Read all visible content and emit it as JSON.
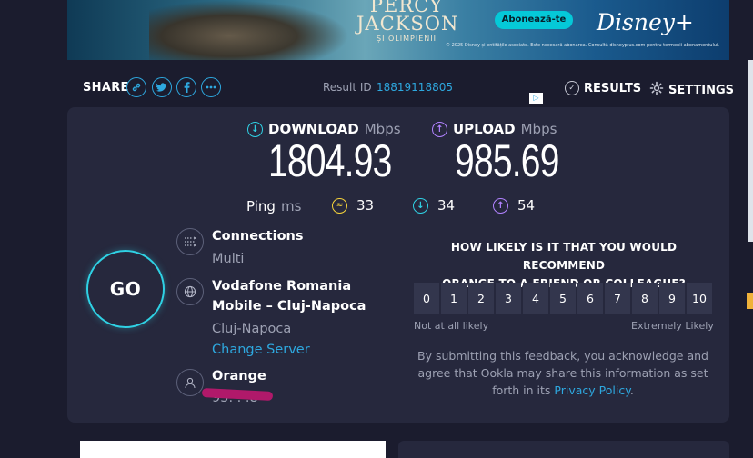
{
  "ad": {
    "title": "PERCY JACKSON",
    "subtitle": "ȘI OLIMPIENII",
    "cta": "Abonează-te",
    "brand": "Disney+",
    "fine_print": "© 2025 Disney și entitățile asociate. Este necesară abonarea. Consultă disneyplus.com pentru termenii abonamentului."
  },
  "share": {
    "label": "SHARE",
    "icons": [
      "link-icon",
      "twitter-icon",
      "facebook-icon",
      "more-icon"
    ]
  },
  "result": {
    "label": "Result ID",
    "id": "18819118805"
  },
  "nav": {
    "results": "RESULTS",
    "settings": "SETTINGS"
  },
  "download": {
    "label": "DOWNLOAD",
    "unit": "Mbps",
    "value": "1804.93",
    "color": "#2fd1e4"
  },
  "upload": {
    "label": "UPLOAD",
    "unit": "Mbps",
    "value": "985.69",
    "color": "#b182ff"
  },
  "ping": {
    "label": "Ping",
    "unit": "ms",
    "idle": "33",
    "download": "34",
    "upload": "54",
    "idle_color": "#f5d33a"
  },
  "go_label": "GO",
  "connections": {
    "title": "Connections",
    "value": "Multi"
  },
  "server": {
    "title_line1": "Vodafone Romania",
    "title_line2": "Mobile – Cluj-Napoca",
    "location": "Cluj-Napoca",
    "change_link": "Change Server"
  },
  "provider": {
    "name": "Orange",
    "ip_masked": "95.  .  .8"
  },
  "nps": {
    "question_line1": "HOW LIKELY IS IT THAT YOU WOULD RECOMMEND",
    "question_line2": "ORANGE TO A FRIEND OR COLLEAGUE?",
    "scale": [
      "0",
      "1",
      "2",
      "3",
      "4",
      "5",
      "6",
      "7",
      "8",
      "9",
      "10"
    ],
    "low_label": "Not at all likely",
    "high_label": "Extremely Likely",
    "note_line1": "By submitting this feedback, you acknowledge and",
    "note_line2": "agree that Ookla may share this information as set",
    "note_line3_prefix": "forth in its ",
    "note_link": "Privacy Policy",
    "note_suffix": "."
  }
}
